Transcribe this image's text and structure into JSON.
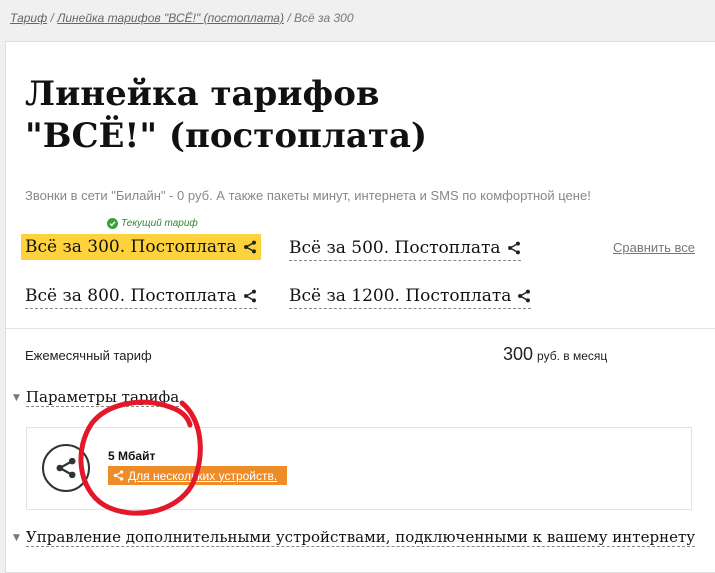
{
  "breadcrumb": {
    "items": [
      "Тариф",
      "Линейка тарифов \"ВСЁ!\" (постоплата)"
    ],
    "separator": "/",
    "current": "Всё за 300"
  },
  "page": {
    "title_line1": "Линейка тарифов",
    "title_line2": "\"ВСЁ!\" (постоплата)",
    "subtitle": "Звонки в сети \"Билайн\" - 0 руб. А также пакеты минут, интернета и SMS по комфортной цене!"
  },
  "tariffs": {
    "current_badge": "Текущий тариф",
    "items": [
      {
        "label": "Всё за 300. Постоплата",
        "active": true
      },
      {
        "label": "Всё за 500. Постоплата",
        "active": false
      },
      {
        "label": "Всё за 800. Постоплата",
        "active": false
      },
      {
        "label": "Всё за 1200. Постоплата",
        "active": false
      }
    ],
    "compare_link": "Сравнить все"
  },
  "monthly": {
    "label": "Ежемесячный тариф",
    "amount": "300",
    "unit": "руб. в месяц"
  },
  "sections": {
    "params_title": "Параметры тарифа",
    "devices_title": "Управление дополнительными устройствами, подключенными к вашему интернету"
  },
  "param": {
    "value": "5 Мбайт",
    "tag": "Для нескольких устройств."
  },
  "colors": {
    "accent_yellow": "#fdd23c",
    "tag_orange": "#ef8c2a",
    "annotation_red": "#e3192b",
    "check_green": "#37a33a"
  },
  "icons": [
    "share-icon",
    "check-icon",
    "triangle-down-icon"
  ]
}
